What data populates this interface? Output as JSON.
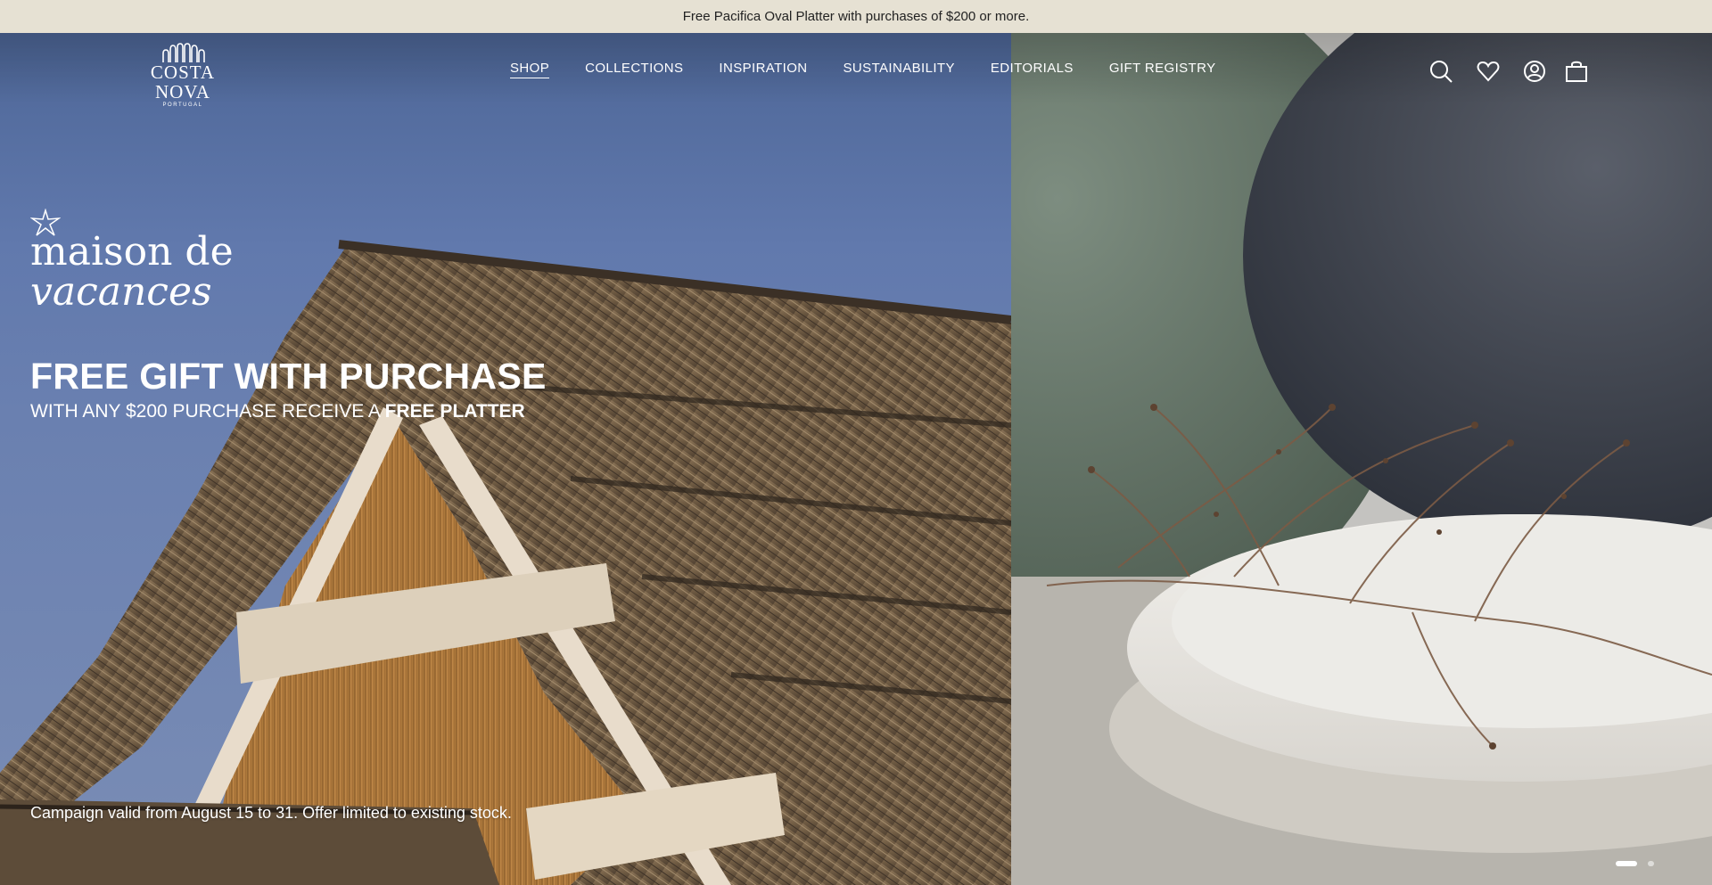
{
  "announcement": {
    "text": "Free Pacifica Oval Platter with purchases of $200 or more."
  },
  "logo": {
    "brand": "COSTA NOVA",
    "sub": "PORTUGAL"
  },
  "nav": {
    "items": [
      {
        "label": "SHOP",
        "active": true
      },
      {
        "label": "COLLECTIONS",
        "active": false
      },
      {
        "label": "INSPIRATION",
        "active": false
      },
      {
        "label": "SUSTAINABILITY",
        "active": false
      },
      {
        "label": "EDITORIALS",
        "active": false
      },
      {
        "label": "GIFT REGISTRY",
        "active": false
      }
    ]
  },
  "header_icons": [
    "search-icon",
    "heart-icon",
    "account-icon",
    "bag-icon"
  ],
  "hero": {
    "script_line_1": "maison de",
    "script_line_2": "vacances",
    "headline": "FREE GIFT WITH PURCHASE",
    "subline_prefix": "WITH ANY $200 PURCHASE RECEIVE A ",
    "subline_emphasis": "FREE PLATTER",
    "footnote": "Campaign valid from August 15 to 31. Offer limited to existing stock."
  },
  "carousel": {
    "slides": 2,
    "active": 1
  },
  "colors": {
    "announcement_bg": "#e6e1d3",
    "text_light": "#ffffff",
    "sky": "#6179ad"
  }
}
